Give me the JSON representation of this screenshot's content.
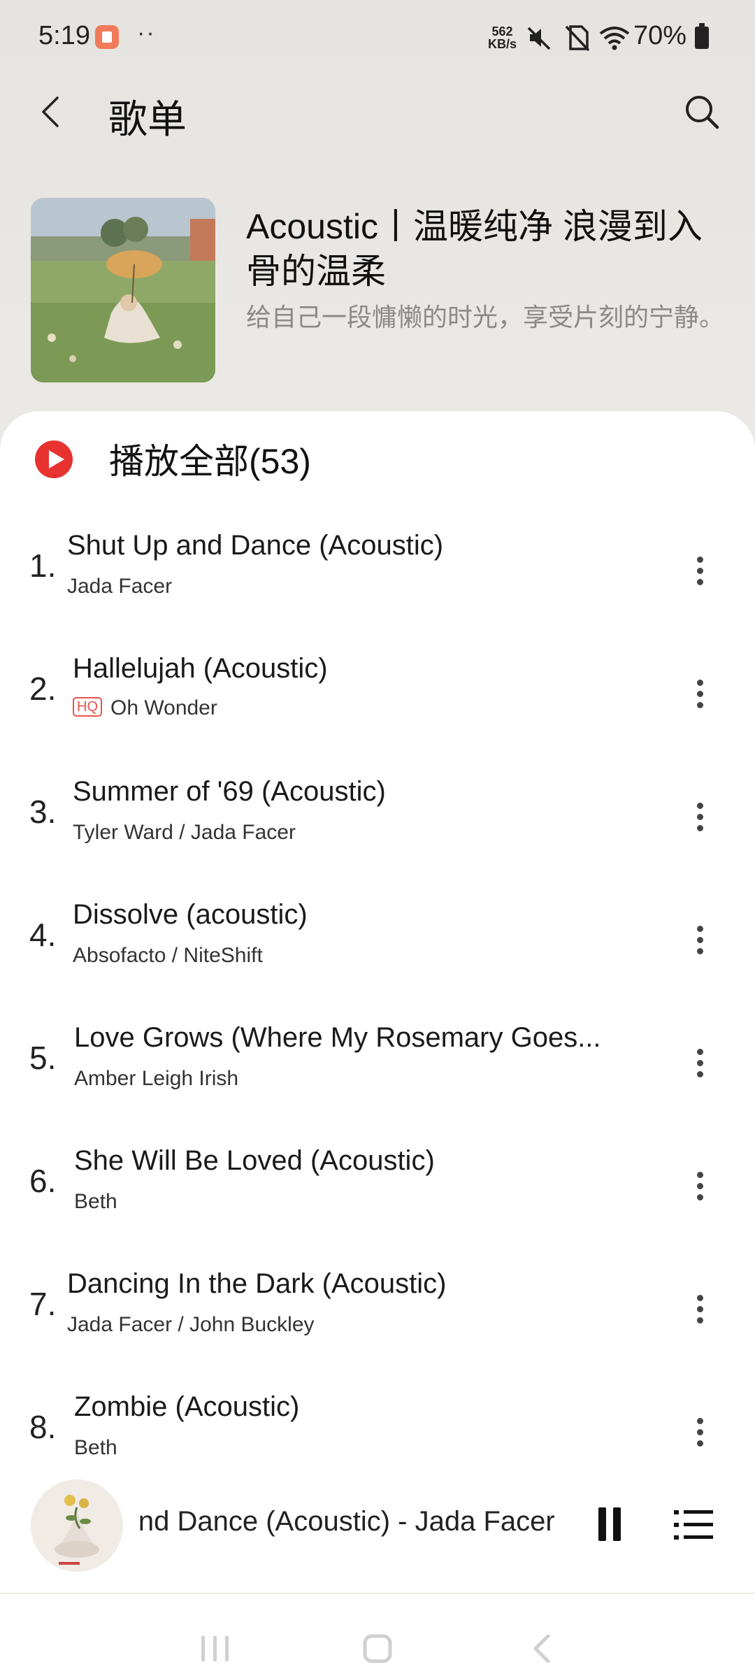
{
  "status": {
    "time": "5:19",
    "dots": "··",
    "net_speed_value": "562",
    "net_speed_unit": "KB/s",
    "battery": "70%"
  },
  "header": {
    "title": "歌单"
  },
  "playlist": {
    "title": "Acoustic丨温暖纯净 浪漫到入骨的温柔",
    "description": "给自己一段慵懒的时光，享受片刻的宁静。"
  },
  "play_all": {
    "label": "播放全部(53)"
  },
  "songs": [
    {
      "num": "1.",
      "title": "Shut Up and Dance (Acoustic)",
      "artist": "Jada Facer",
      "hq": ""
    },
    {
      "num": "2.",
      "title": "Hallelujah (Acoustic)",
      "artist": "Oh Wonder",
      "hq": "HQ"
    },
    {
      "num": "3.",
      "title": "Summer of '69 (Acoustic)",
      "artist": "Tyler Ward / Jada Facer",
      "hq": ""
    },
    {
      "num": "4.",
      "title": "Dissolve (acoustic)",
      "artist": "Absofacto / NiteShift",
      "hq": ""
    },
    {
      "num": "5.",
      "title": "Love Grows (Where My Rosemary Goes...",
      "artist": "Amber Leigh Irish",
      "hq": ""
    },
    {
      "num": "6.",
      "title": "She Will Be Loved (Acoustic)",
      "artist": "Beth",
      "hq": ""
    },
    {
      "num": "7.",
      "title": "Dancing In the Dark (Acoustic)",
      "artist": "Jada Facer / John Buckley",
      "hq": ""
    },
    {
      "num": "8.",
      "title": "Zombie (Acoustic)",
      "artist": "Beth",
      "hq": ""
    }
  ],
  "now_playing": {
    "text": "Shut Up and Dance (Acoustic) - Jada Facer"
  },
  "icons": {
    "back": "chevron-left-icon",
    "search": "search-icon",
    "play_all": "play-circle-icon",
    "more": "more-vertical-icon",
    "pause": "pause-icon",
    "queue": "playlist-icon"
  },
  "colors": {
    "accent": "#e8322f",
    "hq_badge": "#e8554a",
    "secondary_text": "#8a8a8a"
  }
}
